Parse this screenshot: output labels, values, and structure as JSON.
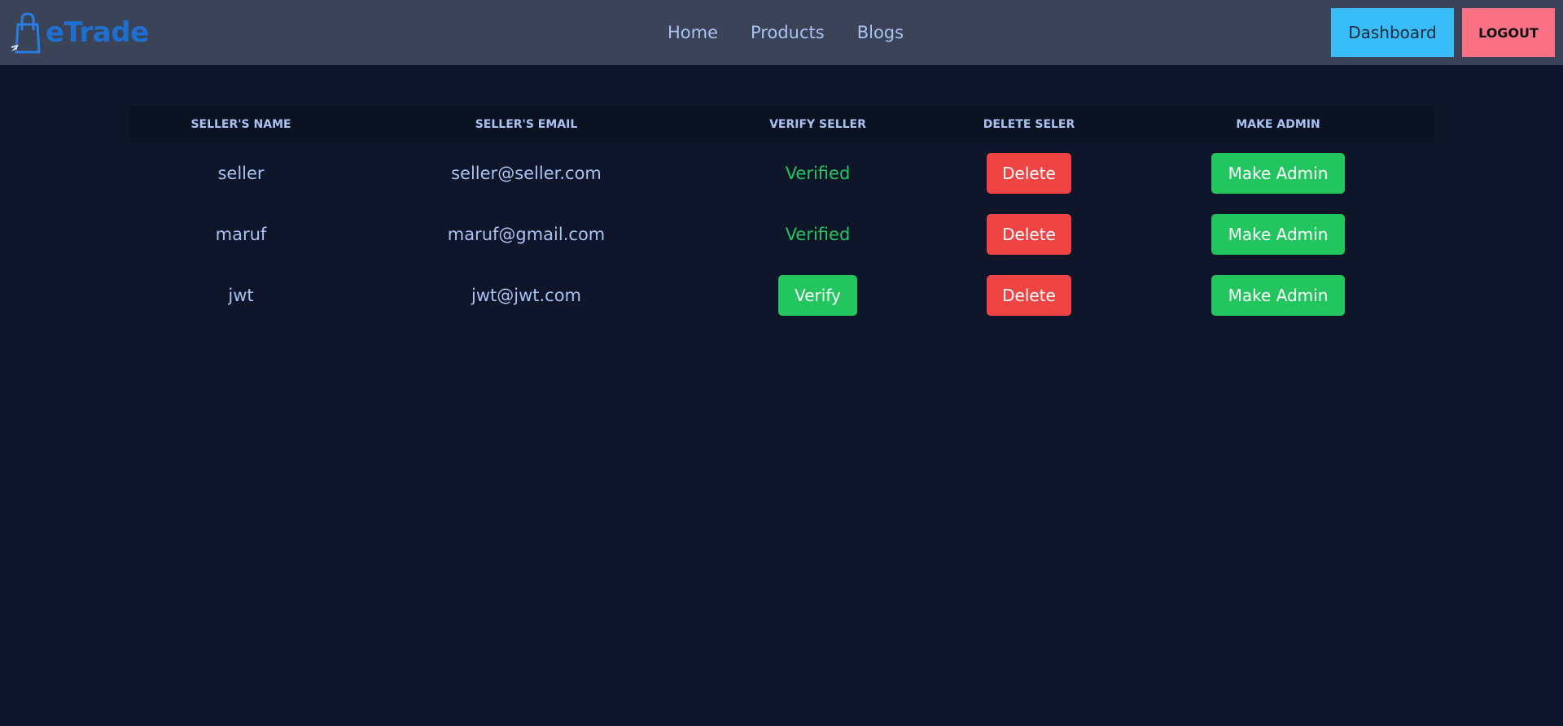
{
  "brand": {
    "name": "eTrade",
    "color": "#1f6fd1"
  },
  "nav": {
    "links": [
      "Home",
      "Products",
      "Blogs"
    ],
    "dashboard_label": "Dashboard",
    "logout_label": "LOGOUT"
  },
  "table": {
    "headers": [
      "SELLER'S NAME",
      "SELLER'S EMAIL",
      "VERIFY SELLER",
      "DELETE SELER",
      "MAKE ADMIN"
    ],
    "rows": [
      {
        "name": "seller",
        "email": "seller@seller.com",
        "status": "Verified",
        "delete_label": "Delete",
        "admin_label": "Make Admin"
      },
      {
        "name": "maruf",
        "email": "maruf@gmail.com",
        "status": "Verified",
        "delete_label": "Delete",
        "admin_label": "Make Admin"
      },
      {
        "name": "jwt",
        "email": "jwt@jwt.com",
        "verify_label": "Verify",
        "delete_label": "Delete",
        "admin_label": "Make Admin"
      }
    ]
  },
  "colors": {
    "background": "#0f1629",
    "navbar": "#3a4456",
    "dashboard_button": "#38bdf8",
    "logout_button": "#fb7185",
    "delete_button": "#ef4444",
    "success": "#22c55e"
  }
}
